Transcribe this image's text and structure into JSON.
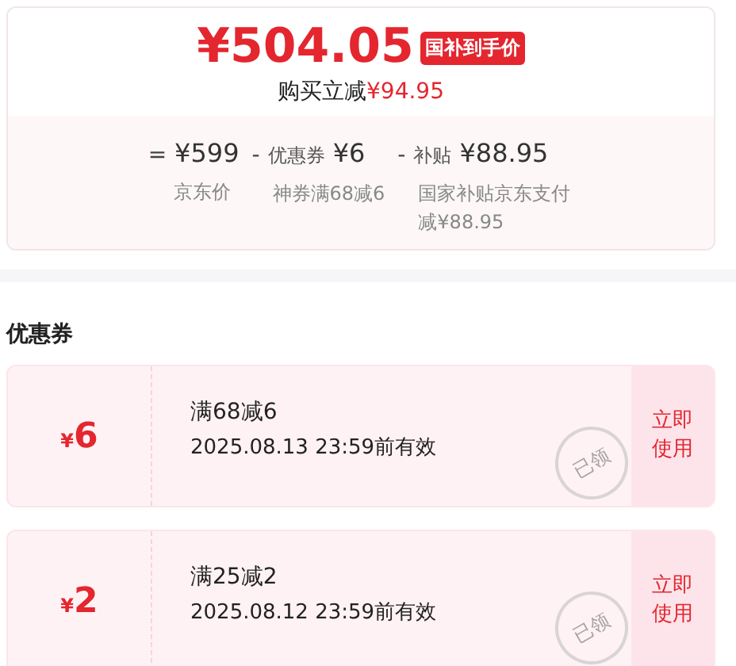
{
  "price_card": {
    "price": "¥504.05",
    "badge": "国补到手价",
    "saving_label": "购买立减",
    "saving_amount": "¥94.95",
    "breakdown": [
      {
        "operator": "=",
        "amount": "¥599",
        "note": "京东价"
      },
      {
        "operator": "-",
        "label": "优惠券",
        "amount": "¥6",
        "note": "神券满68减6"
      },
      {
        "operator": "-",
        "label": "补贴",
        "amount": "¥88.95",
        "note": "国家补贴京东支付减¥88.95"
      }
    ]
  },
  "coupons_section": {
    "title": "优惠券",
    "coupons": [
      {
        "value_symbol": "¥",
        "value": "6",
        "condition": "满68减6",
        "validity": "2025.08.13 23:59前有效",
        "stamp": "已领",
        "action": "立即使用"
      },
      {
        "value_symbol": "¥",
        "value": "2",
        "condition": "满25减2",
        "validity": "2025.08.12 23:59前有效",
        "stamp": "已领",
        "action": "立即使用"
      }
    ]
  }
}
